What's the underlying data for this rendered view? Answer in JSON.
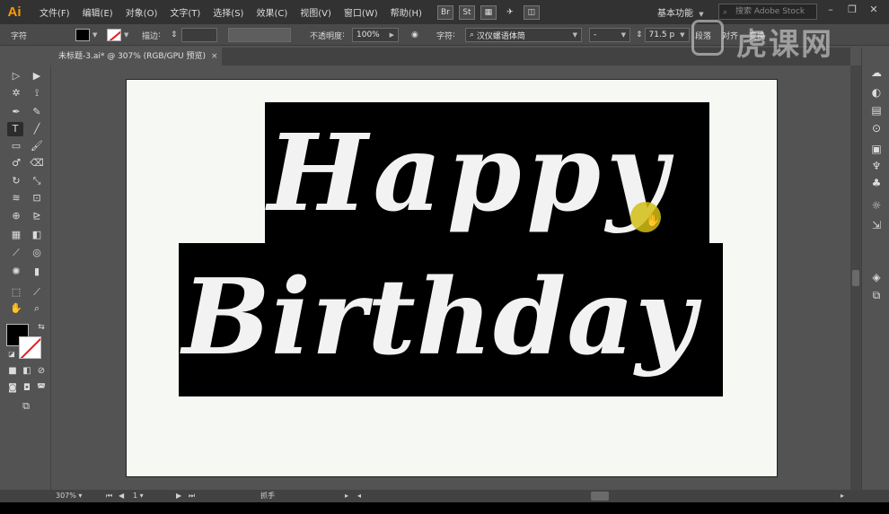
{
  "app": {
    "logo": "Ai"
  },
  "menubar": {
    "items": [
      "文件(F)",
      "编辑(E)",
      "对象(O)",
      "文字(T)",
      "选择(S)",
      "效果(C)",
      "视图(V)",
      "窗口(W)",
      "帮助(H)"
    ],
    "br_label": "Br",
    "st_label": "St",
    "workspace": "基本功能",
    "stock_placeholder": "搜索 Adobe Stock"
  },
  "controlbar": {
    "panel_label": "字符",
    "stroke_label": "描边",
    "opacity_label": "不透明度",
    "opacity_value": "100%",
    "character_label": "字符",
    "font_family": "汉仪螺语体简",
    "font_style": "-",
    "font_size": "71.5 p",
    "paragraph_label": "段落",
    "align_label": "对齐",
    "transform_label": "变换"
  },
  "document": {
    "tab_title": "未标题-3.ai* @ 307% (RGB/GPU 预览)",
    "close_glyph": "×"
  },
  "artwork": {
    "line1": "Happy",
    "line2": "Birthday",
    "text_color": "#f2f2f2",
    "background_color": "#000000",
    "artboard_color": "#f6f9f3"
  },
  "statusbar": {
    "zoom": "307%",
    "page": "1",
    "tool_name": "抓手"
  },
  "watermark": {
    "text": "虎课网"
  },
  "colors": {
    "menubar_bg": "#323232",
    "panel_bg": "#535353",
    "controlbar_bg": "#4a4a4a",
    "ai_orange": "#ff9a00",
    "cursor_highlight": "#d2be14"
  }
}
